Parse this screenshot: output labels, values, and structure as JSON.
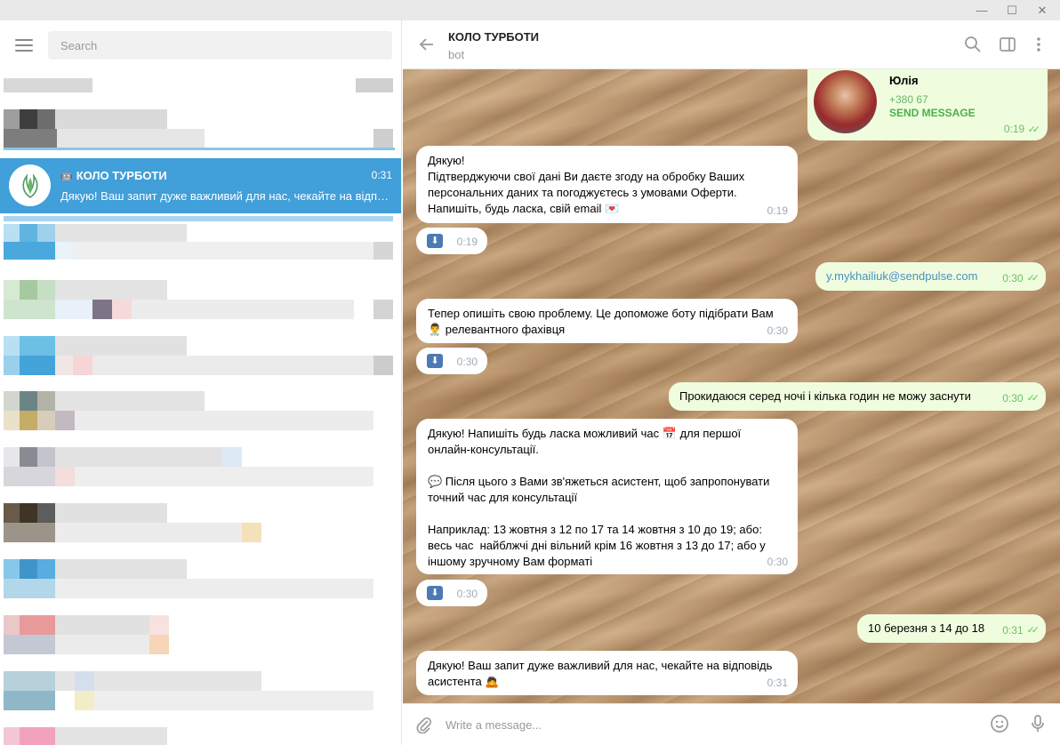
{
  "window": {
    "minimize_glyph": "—",
    "maximize_glyph": "☐",
    "close_glyph": "✕"
  },
  "sidebar": {
    "search_placeholder": "Search",
    "active_chat": {
      "name": "КОЛО ТУРБОТИ",
      "time": "0:31",
      "preview": "Дякую! Ваш запит дуже важливий для нас, чекайте на відповідь асистента"
    }
  },
  "header": {
    "peer_name": "КОЛО ТУРБОТИ",
    "peer_status": "bot"
  },
  "messages": {
    "contact": {
      "name": "Юлія",
      "phone": "+380 67",
      "action": "SEND MESSAGE",
      "time": "0:19"
    },
    "m1": {
      "text": "Дякую!\nПідтверджуючи свої дані Ви даєте згоду на обробку Ваших персональних даних та погоджуєтесь з умовами Оферти.\nНапишіть, будь ласка, свій email 💌",
      "time": "0:19"
    },
    "f1": {
      "time": "0:19"
    },
    "o1": {
      "text": "y.mykhailiuk@sendpulse.com",
      "time": "0:30"
    },
    "m2": {
      "text": "Тепер опишіть свою проблему. Це допоможе боту підібрати Вам 👨‍⚕️ релевантного фахівця",
      "time": "0:30"
    },
    "f2": {
      "time": "0:30"
    },
    "o2": {
      "text": "Прокидаюся серед ночі і кілька годин не можу заснути",
      "time": "0:30"
    },
    "m3": {
      "text": "Дякую! Напишіть будь ласка можливий час 📅 для першої онлайн-консультації.\n\n💬 Після цього з Вами зв'яжеться асистент, щоб запропонувати точний час для консультації\n\nНаприклад: 13 жовтня з 12 по 17 та 14 жовтня з 10 до 19; або: весь час  найблжчі дні вільний крім 16 жовтня з 13 до 17; або у іншому зручному Вам форматі",
      "time": "0:30"
    },
    "f3": {
      "time": "0:30"
    },
    "o3": {
      "text": "10 березня з 14 до 18",
      "time": "0:31"
    },
    "m4": {
      "text": "Дякую! Ваш запит дуже важливий для нас, чекайте на відповідь асистента 🙇",
      "time": "0:31"
    }
  },
  "composer": {
    "placeholder": "Write a message..."
  },
  "colors": {
    "active_chat_bg": "#419fd9",
    "outgoing_bubble": "#effdde",
    "incoming_bubble": "#ffffff",
    "read_check": "#5dc452"
  },
  "icons": [
    "menu-icon",
    "search-icon",
    "back-arrow-icon",
    "sidebar-toggle-icon",
    "more-vertical-icon",
    "paperclip-icon",
    "emoji-icon",
    "microphone-icon",
    "bot-icon",
    "download-icon",
    "double-check-icon"
  ]
}
